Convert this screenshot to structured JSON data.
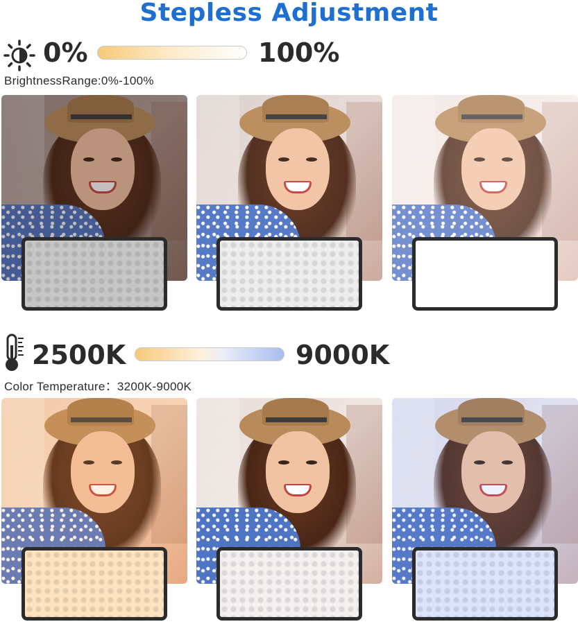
{
  "title": "Stepless Adjustment",
  "brightness": {
    "icon": "sun-brightness-icon",
    "min_label": "0%",
    "max_label": "100%",
    "range_label": "BrightnessRange:0%-100%",
    "gradient_colors": [
      "#f7c978",
      "#ffffff"
    ],
    "panel_levels": [
      "low",
      "medium",
      "high"
    ]
  },
  "color_temperature": {
    "icon": "thermometer-icon",
    "min_label": "2500K",
    "max_label": "9000K",
    "range_label": "Color Temperature：3200K-9000K",
    "gradient_colors": [
      "#f7c978",
      "#ffffff",
      "#a9bdf0"
    ],
    "panel_tones": [
      "warm",
      "neutral",
      "cool"
    ]
  },
  "colors": {
    "title": "#1e6fd1",
    "text": "#2b2b2b"
  }
}
